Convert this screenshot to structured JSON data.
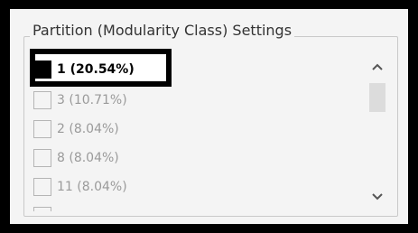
{
  "group": {
    "title": "Partition (Modularity Class) Settings"
  },
  "partitions": [
    {
      "label": "1 (20.54%)",
      "selected": true,
      "color": "#000000"
    },
    {
      "label": "3 (10.71%)",
      "selected": false
    },
    {
      "label": "2 (8.04%)",
      "selected": false
    },
    {
      "label": "8 (8.04%)",
      "selected": false
    },
    {
      "label": "11 (8.04%)",
      "selected": false
    }
  ],
  "scrollbar": {
    "up_icon": "chevron-up-icon",
    "down_icon": "chevron-down-icon"
  },
  "colors": {
    "outer_border": "#000000",
    "panel_background": "#f4f4f4",
    "disabled_text": "#9a9a9a",
    "selected_swatch": "#000000"
  }
}
